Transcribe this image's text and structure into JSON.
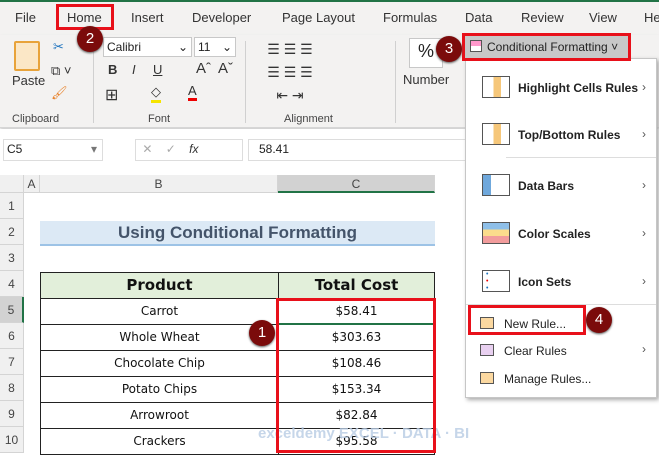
{
  "tabs": [
    "File",
    "Home",
    "Insert",
    "Developer",
    "Page Layout",
    "Formulas",
    "Data",
    "Review",
    "View",
    "He"
  ],
  "ribbon": {
    "paste": "Paste",
    "font_name": "Calibri",
    "font_size": "11",
    "bold": "B",
    "italic": "I",
    "underline": "U",
    "groups": {
      "clipboard": "Clipboard",
      "font": "Font",
      "alignment": "Alignment",
      "number": "Number"
    },
    "percent": "%",
    "cf_button": "Conditional Formatting"
  },
  "formula_bar": {
    "name_box": "C5",
    "fx": "fx",
    "value": "58.41"
  },
  "columns": [
    "A",
    "B",
    "C"
  ],
  "rows": [
    "1",
    "2",
    "3",
    "4",
    "5",
    "6",
    "7",
    "8",
    "9",
    "10"
  ],
  "sheet": {
    "title": "Using Conditional Formatting",
    "headers": [
      "Product",
      "Total Cost"
    ],
    "data": [
      [
        "Carrot",
        "$58.41"
      ],
      [
        "Whole Wheat",
        "$303.63"
      ],
      [
        "Chocolate Chip",
        "$108.46"
      ],
      [
        "Potato Chips",
        "$153.34"
      ],
      [
        "Arrowroot",
        "$82.84"
      ],
      [
        "Crackers",
        "$95.58"
      ]
    ]
  },
  "menu": {
    "items": [
      "Highlight Cells Rules",
      "Top/Bottom Rules",
      "Data Bars",
      "Color Scales",
      "Icon Sets"
    ],
    "new_rule": "New Rule...",
    "clear_rules": "Clear Rules",
    "manage_rules": "Manage Rules..."
  },
  "steps": [
    "1",
    "2",
    "3",
    "4"
  ],
  "watermark": "exceldemy EXCEL · DATA · BI",
  "colors": {
    "accent": "#217346",
    "marker": "#e8101a",
    "badge": "#7b0b0b",
    "title_fill": "#dce9f5",
    "header_fill": "#e2efda"
  }
}
